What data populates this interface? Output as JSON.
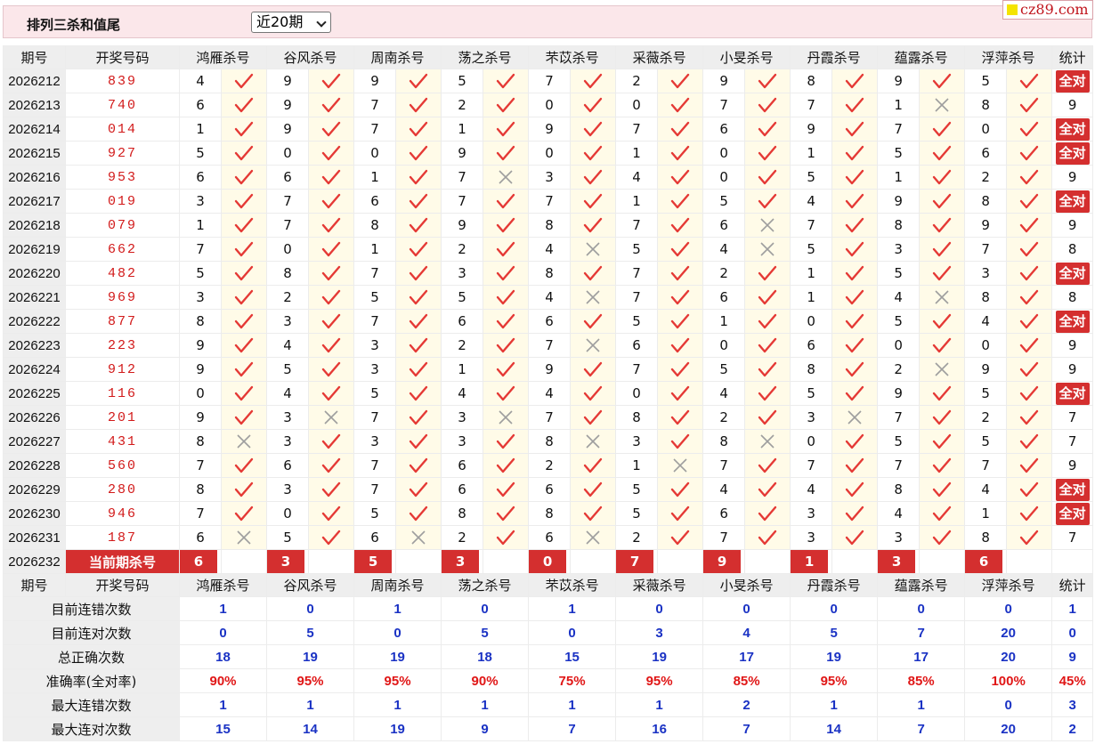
{
  "header": {
    "title": "排列三杀和值尾",
    "period_select": "近20期",
    "logo_text": "cz89.com"
  },
  "colors": {
    "accent": "#d42f2f",
    "header_bg": "#fbe7ea",
    "check": "#e53935",
    "cross": "#9e9e9e",
    "stat_blue": "#1a32c4"
  },
  "icons": {
    "hit": "check-mark-icon",
    "miss": "cross-mark-icon"
  },
  "columns": {
    "issue": "期号",
    "draw": "开奖号码",
    "experts": [
      "鸿雁杀号",
      "谷风杀号",
      "周南杀号",
      "荡之杀号",
      "芣苡杀号",
      "采薇杀号",
      "小旻杀号",
      "丹霞杀号",
      "蕴露杀号",
      "浮萍杀号"
    ],
    "stat": "统计"
  },
  "all_correct_label": "全对",
  "rows": [
    {
      "issue": "2026212",
      "draw": "839",
      "kills": [
        "4",
        "9",
        "9",
        "5",
        "7",
        "2",
        "9",
        "8",
        "9",
        "5"
      ],
      "hits": [
        1,
        1,
        1,
        1,
        1,
        1,
        1,
        1,
        1,
        1
      ],
      "stat": "全对"
    },
    {
      "issue": "2026213",
      "draw": "740",
      "kills": [
        "6",
        "9",
        "7",
        "2",
        "0",
        "0",
        "7",
        "7",
        "1",
        "8"
      ],
      "hits": [
        1,
        1,
        1,
        1,
        1,
        1,
        1,
        1,
        0,
        1
      ],
      "stat": "9"
    },
    {
      "issue": "2026214",
      "draw": "014",
      "kills": [
        "1",
        "9",
        "7",
        "1",
        "9",
        "7",
        "6",
        "9",
        "7",
        "0"
      ],
      "hits": [
        1,
        1,
        1,
        1,
        1,
        1,
        1,
        1,
        1,
        1
      ],
      "stat": "全对"
    },
    {
      "issue": "2026215",
      "draw": "927",
      "kills": [
        "5",
        "0",
        "0",
        "9",
        "0",
        "1",
        "0",
        "1",
        "5",
        "6"
      ],
      "hits": [
        1,
        1,
        1,
        1,
        1,
        1,
        1,
        1,
        1,
        1
      ],
      "stat": "全对"
    },
    {
      "issue": "2026216",
      "draw": "953",
      "kills": [
        "6",
        "6",
        "1",
        "7",
        "3",
        "4",
        "0",
        "5",
        "1",
        "2"
      ],
      "hits": [
        1,
        1,
        1,
        0,
        1,
        1,
        1,
        1,
        1,
        1
      ],
      "stat": "9"
    },
    {
      "issue": "2026217",
      "draw": "019",
      "kills": [
        "3",
        "7",
        "6",
        "7",
        "7",
        "1",
        "5",
        "4",
        "9",
        "8"
      ],
      "hits": [
        1,
        1,
        1,
        1,
        1,
        1,
        1,
        1,
        1,
        1
      ],
      "stat": "全对"
    },
    {
      "issue": "2026218",
      "draw": "079",
      "kills": [
        "1",
        "7",
        "8",
        "9",
        "8",
        "7",
        "6",
        "7",
        "8",
        "9"
      ],
      "hits": [
        1,
        1,
        1,
        1,
        1,
        1,
        0,
        1,
        1,
        1
      ],
      "stat": "9"
    },
    {
      "issue": "2026219",
      "draw": "662",
      "kills": [
        "7",
        "0",
        "1",
        "2",
        "4",
        "5",
        "4",
        "5",
        "3",
        "7"
      ],
      "hits": [
        1,
        1,
        1,
        1,
        0,
        1,
        0,
        1,
        1,
        1
      ],
      "stat": "8"
    },
    {
      "issue": "2026220",
      "draw": "482",
      "kills": [
        "5",
        "8",
        "7",
        "3",
        "8",
        "7",
        "2",
        "1",
        "5",
        "3"
      ],
      "hits": [
        1,
        1,
        1,
        1,
        1,
        1,
        1,
        1,
        1,
        1
      ],
      "stat": "全对"
    },
    {
      "issue": "2026221",
      "draw": "969",
      "kills": [
        "3",
        "2",
        "5",
        "5",
        "4",
        "7",
        "6",
        "1",
        "4",
        "8"
      ],
      "hits": [
        1,
        1,
        1,
        1,
        0,
        1,
        1,
        1,
        0,
        1
      ],
      "stat": "8"
    },
    {
      "issue": "2026222",
      "draw": "877",
      "kills": [
        "8",
        "3",
        "7",
        "6",
        "6",
        "5",
        "1",
        "0",
        "5",
        "4"
      ],
      "hits": [
        1,
        1,
        1,
        1,
        1,
        1,
        1,
        1,
        1,
        1
      ],
      "stat": "全对"
    },
    {
      "issue": "2026223",
      "draw": "223",
      "kills": [
        "9",
        "4",
        "3",
        "2",
        "7",
        "6",
        "0",
        "6",
        "0",
        "0"
      ],
      "hits": [
        1,
        1,
        1,
        1,
        0,
        1,
        1,
        1,
        1,
        1
      ],
      "stat": "9"
    },
    {
      "issue": "2026224",
      "draw": "912",
      "kills": [
        "9",
        "5",
        "3",
        "1",
        "9",
        "7",
        "5",
        "8",
        "2",
        "9"
      ],
      "hits": [
        1,
        1,
        1,
        1,
        1,
        1,
        1,
        1,
        0,
        1
      ],
      "stat": "9"
    },
    {
      "issue": "2026225",
      "draw": "116",
      "kills": [
        "0",
        "4",
        "5",
        "4",
        "4",
        "0",
        "4",
        "5",
        "9",
        "5"
      ],
      "hits": [
        1,
        1,
        1,
        1,
        1,
        1,
        1,
        1,
        1,
        1
      ],
      "stat": "全对"
    },
    {
      "issue": "2026226",
      "draw": "201",
      "kills": [
        "9",
        "3",
        "7",
        "3",
        "7",
        "8",
        "2",
        "3",
        "7",
        "2"
      ],
      "hits": [
        1,
        0,
        1,
        0,
        1,
        1,
        1,
        0,
        1,
        1
      ],
      "stat": "7"
    },
    {
      "issue": "2026227",
      "draw": "431",
      "kills": [
        "8",
        "3",
        "3",
        "3",
        "8",
        "3",
        "8",
        "0",
        "5",
        "5"
      ],
      "hits": [
        0,
        1,
        1,
        1,
        0,
        1,
        0,
        1,
        1,
        1
      ],
      "stat": "7"
    },
    {
      "issue": "2026228",
      "draw": "560",
      "kills": [
        "7",
        "6",
        "7",
        "6",
        "2",
        "1",
        "7",
        "7",
        "7",
        "7"
      ],
      "hits": [
        1,
        1,
        1,
        1,
        1,
        0,
        1,
        1,
        1,
        1
      ],
      "stat": "9"
    },
    {
      "issue": "2026229",
      "draw": "280",
      "kills": [
        "8",
        "3",
        "7",
        "6",
        "6",
        "5",
        "4",
        "4",
        "8",
        "4"
      ],
      "hits": [
        1,
        1,
        1,
        1,
        1,
        1,
        1,
        1,
        1,
        1
      ],
      "stat": "全对"
    },
    {
      "issue": "2026230",
      "draw": "946",
      "kills": [
        "7",
        "0",
        "5",
        "8",
        "8",
        "5",
        "6",
        "3",
        "4",
        "1"
      ],
      "hits": [
        1,
        1,
        1,
        1,
        1,
        1,
        1,
        1,
        1,
        1
      ],
      "stat": "全对"
    },
    {
      "issue": "2026231",
      "draw": "187",
      "kills": [
        "6",
        "5",
        "6",
        "2",
        "6",
        "2",
        "7",
        "3",
        "3",
        "8"
      ],
      "hits": [
        0,
        1,
        0,
        1,
        0,
        1,
        1,
        1,
        1,
        1
      ],
      "stat": "7"
    }
  ],
  "current": {
    "issue": "2026232",
    "label": "当前期杀号",
    "kills": [
      "6",
      "3",
      "5",
      "3",
      "0",
      "7",
      "9",
      "1",
      "3",
      "6"
    ]
  },
  "stats": [
    {
      "label": "目前连错次数",
      "values": [
        "1",
        "0",
        "1",
        "0",
        "1",
        "0",
        "0",
        "0",
        "0",
        "0"
      ],
      "total": "1"
    },
    {
      "label": "目前连对次数",
      "values": [
        "0",
        "5",
        "0",
        "5",
        "0",
        "3",
        "4",
        "5",
        "7",
        "20"
      ],
      "total": "0"
    },
    {
      "label": "总正确次数",
      "values": [
        "18",
        "19",
        "19",
        "18",
        "15",
        "19",
        "17",
        "19",
        "17",
        "20"
      ],
      "total": "9"
    },
    {
      "label": "准确率(全对率)",
      "values": [
        "90%",
        "95%",
        "95%",
        "90%",
        "75%",
        "95%",
        "85%",
        "95%",
        "85%",
        "100%"
      ],
      "total": "45%"
    },
    {
      "label": "最大连错次数",
      "values": [
        "1",
        "1",
        "1",
        "1",
        "1",
        "1",
        "2",
        "1",
        "1",
        "0"
      ],
      "total": "3"
    },
    {
      "label": "最大连对次数",
      "values": [
        "15",
        "14",
        "19",
        "9",
        "7",
        "16",
        "7",
        "14",
        "7",
        "20"
      ],
      "total": "2"
    }
  ]
}
